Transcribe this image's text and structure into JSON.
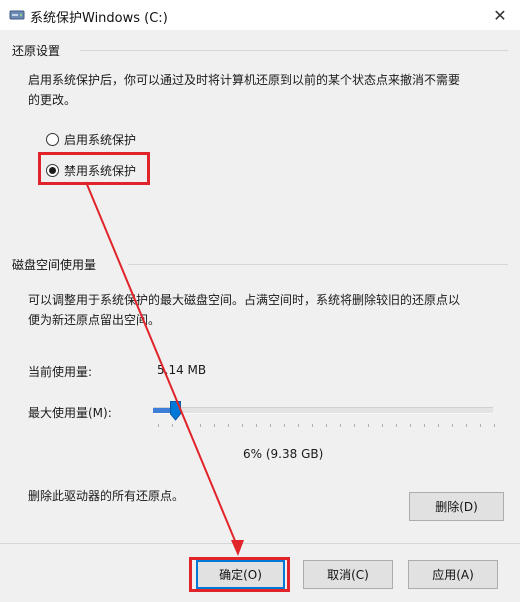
{
  "window": {
    "title": "系统保护Windows (C:)",
    "close_glyph": "✕"
  },
  "restore_settings": {
    "group_title": "还原设置",
    "description_line1": "启用系统保护后，你可以通过及时将计算机还原到以前的某个状态点来撤消不需要",
    "description_line2": "的更改。",
    "options": [
      {
        "label": "启用系统保护",
        "selected": false
      },
      {
        "label": "禁用系统保护",
        "selected": true
      }
    ]
  },
  "disk_usage": {
    "group_title": "磁盘空间使用量",
    "description_line1": "可以调整用于系统保护的最大磁盘空间。占满空间时，系统将删除较旧的还原点以",
    "description_line2": "便为新还原点留出空间。",
    "current_label": "当前使用量:",
    "current_value": "5.14 MB",
    "max_label": "最大使用量(M):",
    "slider_percent": 6,
    "slider_value_text": "6% (9.38 GB)",
    "delete_text": "删除此驱动器的所有还原点。",
    "delete_button": "删除(D)"
  },
  "footer": {
    "ok_button": "确定(O)",
    "cancel_button": "取消(C)",
    "apply_button": "应用(A)"
  },
  "colors": {
    "annotation_red": "#e0242a",
    "slider_blue": "#3e7ed8",
    "focus_blue": "#0078d7"
  },
  "icons": {
    "title": "drive-shield-icon",
    "close": "close-icon"
  }
}
